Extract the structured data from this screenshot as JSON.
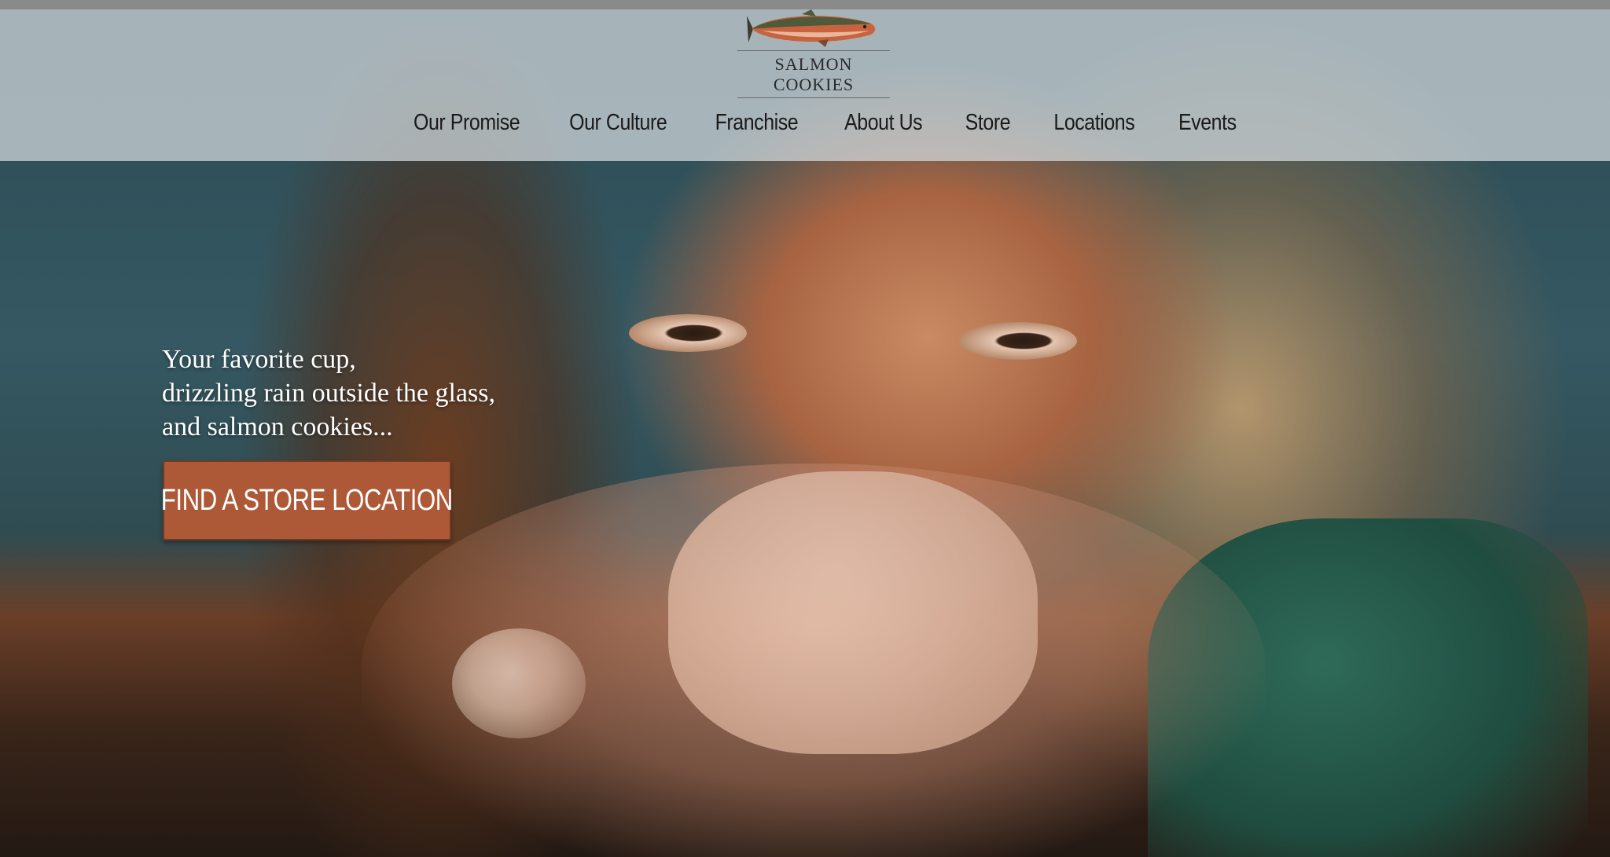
{
  "header": {
    "logo_text": "SALMON COOKIES",
    "nav": [
      {
        "label": "Our Promise"
      },
      {
        "label": "Our Culture"
      },
      {
        "label": "Franchise"
      },
      {
        "label": "About Us"
      },
      {
        "label": "Store"
      },
      {
        "label": "Locations"
      },
      {
        "label": "Events"
      }
    ]
  },
  "hero": {
    "tagline": [
      "Your favorite cup,",
      "drizzling rain outside the glass,",
      "and salmon cookies..."
    ],
    "cta_label": "FIND A STORE LOCATION"
  },
  "colors": {
    "cta_background": "#ad5938",
    "header_overlay": "#d6dce0",
    "nav_text": "#1a1a1a"
  },
  "icons": {
    "logo": "salmon-fish-icon"
  }
}
